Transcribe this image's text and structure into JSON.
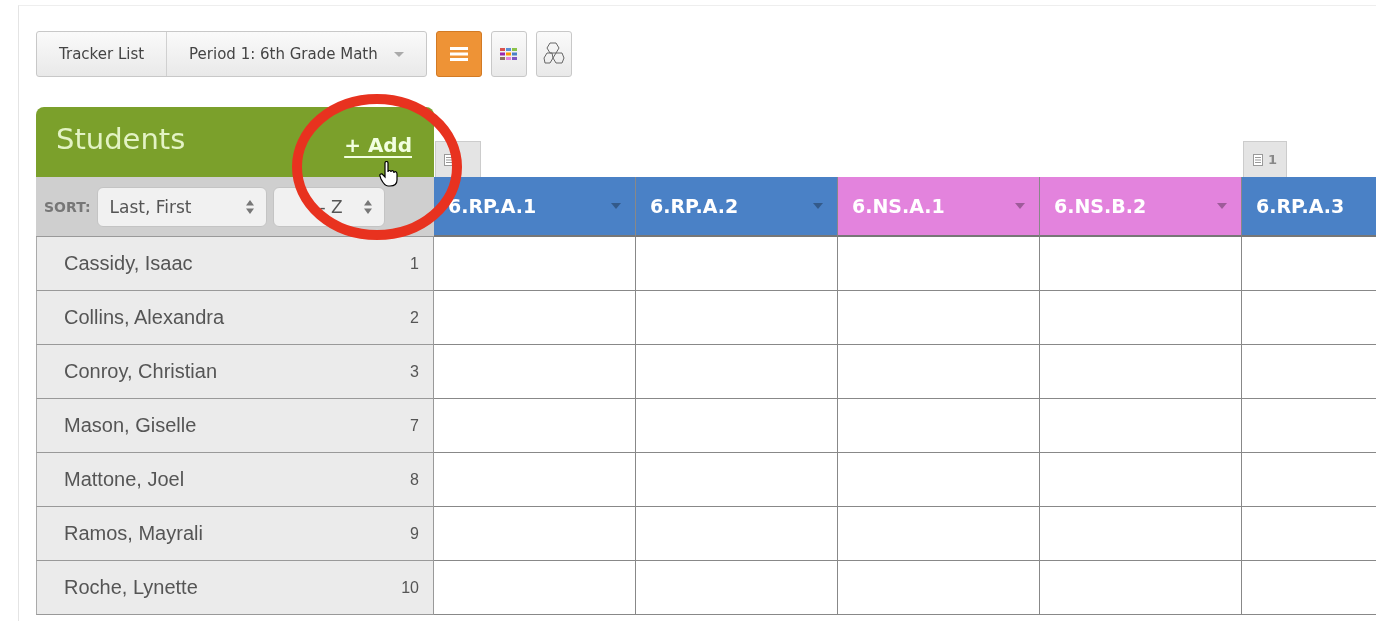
{
  "toolbar": {
    "tracker_button": "Tracker List",
    "period_select": "Period 1: 6th Grade Math",
    "views": [
      {
        "kind": "list",
        "selected": true
      },
      {
        "kind": "grid",
        "selected": false
      },
      {
        "kind": "hexagon",
        "selected": false
      }
    ]
  },
  "students_panel": {
    "title": "Students",
    "add_link": "+ Add",
    "sort_label": "SORT:",
    "sort_field": "Last, First",
    "sort_order": "- Z"
  },
  "columns": [
    {
      "label": "6.RP.A.1",
      "color": "#4a81c6",
      "dropdown": true,
      "notes": true
    },
    {
      "label": "6.RP.A.2",
      "color": "#4a81c6",
      "dropdown": true,
      "notes": false
    },
    {
      "label": "6.NS.A.1",
      "color": "#e383dd",
      "dropdown": true,
      "notes": false
    },
    {
      "label": "6.NS.B.2",
      "color": "#e383dd",
      "dropdown": true,
      "notes": false
    },
    {
      "label": "6.RP.A.3",
      "color": "#4a81c6",
      "dropdown": false,
      "notes": true,
      "note_count": "1"
    }
  ],
  "students": [
    {
      "name": "Cassidy, Isaac",
      "number": "1"
    },
    {
      "name": "Collins, Alexandra",
      "number": "2"
    },
    {
      "name": "Conroy, Christian",
      "number": "3"
    },
    {
      "name": "Mason, Giselle",
      "number": "7"
    },
    {
      "name": "Mattone, Joel",
      "number": "8"
    },
    {
      "name": "Ramos, Mayrali",
      "number": "9"
    },
    {
      "name": "Roche, Lynette",
      "number": "10"
    }
  ]
}
